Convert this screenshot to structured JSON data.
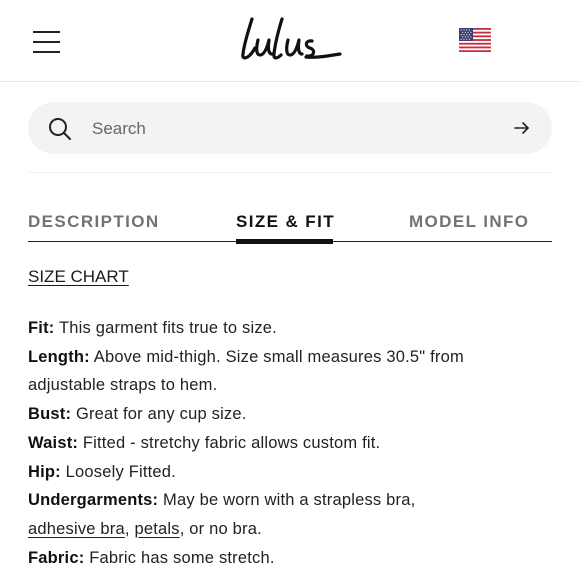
{
  "header": {
    "logo_text": "lulus",
    "menu_icon": "hamburger-menu-icon",
    "flag_icon": "us-flag-icon"
  },
  "search": {
    "placeholder": "Search",
    "value": "",
    "icon": "search-icon",
    "submit_icon": "arrow-right-icon"
  },
  "tabs": [
    {
      "label": "DESCRIPTION",
      "active": false
    },
    {
      "label": "SIZE & FIT",
      "active": true
    },
    {
      "label": "MODEL INFO",
      "active": false
    }
  ],
  "size_chart_label": "SIZE CHART",
  "details": {
    "fit": {
      "label": "Fit:",
      "text": " This garment fits true to size."
    },
    "length": {
      "label": "Length:",
      "text_line1": " Above mid-thigh. Size small measures 30.5\" from",
      "text_line2": "adjustable straps to hem."
    },
    "bust": {
      "label": "Bust:",
      "text": " Great for any cup size."
    },
    "waist": {
      "label": "Waist:",
      "text": " Fitted - stretchy fabric allows custom fit."
    },
    "hip": {
      "label": "Hip:",
      "text": " Loosely Fitted."
    },
    "undergarments": {
      "label": "Undergarments:",
      "text_line1": " May be worn with a strapless bra,",
      "link1": "adhesive bra",
      "sep1": ", ",
      "link2": "petals",
      "tail": ", or no bra."
    },
    "fabric": {
      "label": "Fabric:",
      "text": " Fabric has some stretch."
    }
  },
  "colors": {
    "text": "#1a1a1a",
    "inactive_tab": "#737373",
    "search_bg": "#f3f3f3"
  }
}
